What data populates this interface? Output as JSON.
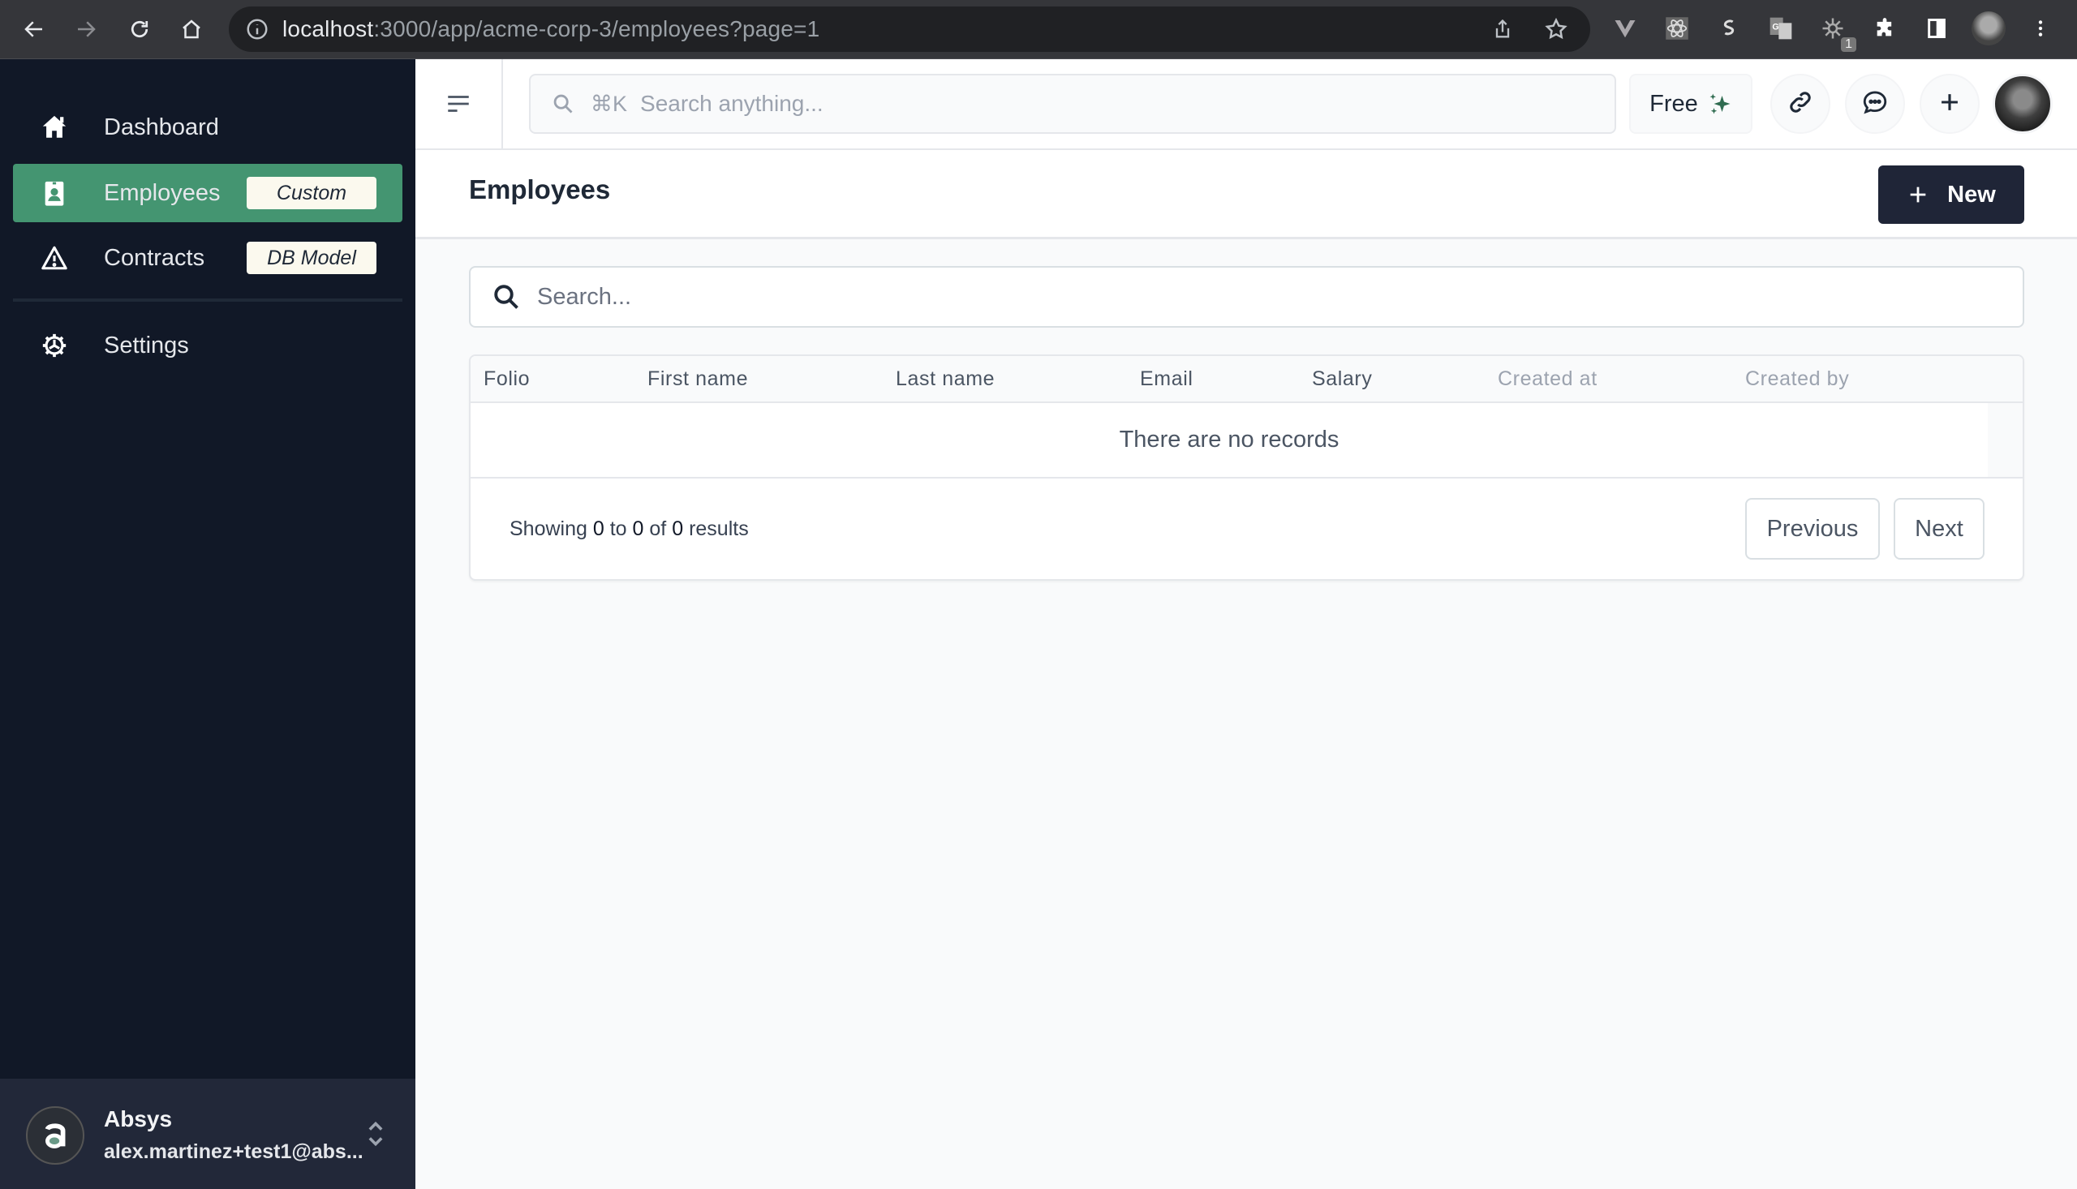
{
  "browser": {
    "url_host": "localhost",
    "url_rest": ":3000/app/acme-corp-3/employees?page=1",
    "extension_badge": "1"
  },
  "sidebar": {
    "items": [
      {
        "label": "Dashboard",
        "icon": "home-icon",
        "tag": null,
        "active": false
      },
      {
        "label": "Employees",
        "icon": "id-badge-icon",
        "tag": "Custom",
        "active": true
      },
      {
        "label": "Contracts",
        "icon": "warning-triangle-icon",
        "tag": "DB Model",
        "active": false
      },
      {
        "label": "Settings",
        "icon": "gear-icon",
        "tag": null,
        "active": false
      }
    ],
    "user": {
      "name": "Absys",
      "email": "alex.martinez+test1@abs..."
    },
    "active_color": "#449571",
    "background_color": "#111827"
  },
  "topbar": {
    "search_shortcut": "⌘K",
    "search_placeholder": "Search anything...",
    "plan_label": "Free"
  },
  "page": {
    "title": "Employees",
    "new_button_label": "New",
    "search_placeholder": "Search..."
  },
  "table": {
    "columns": [
      {
        "label": "Folio",
        "sortable": true
      },
      {
        "label": "First name",
        "sortable": true
      },
      {
        "label": "Last name",
        "sortable": true
      },
      {
        "label": "Email",
        "sortable": true
      },
      {
        "label": "Salary",
        "sortable": true
      },
      {
        "label": "Created at",
        "sortable": false
      },
      {
        "label": "Created by",
        "sortable": false
      }
    ],
    "rows": [],
    "empty_message": "There are no records",
    "pagination": {
      "prefix": "Showing",
      "from": "0",
      "to_word": "to",
      "to": "0",
      "of_word": "of",
      "total": "0",
      "suffix": "results",
      "previous_label": "Previous",
      "next_label": "Next"
    }
  }
}
